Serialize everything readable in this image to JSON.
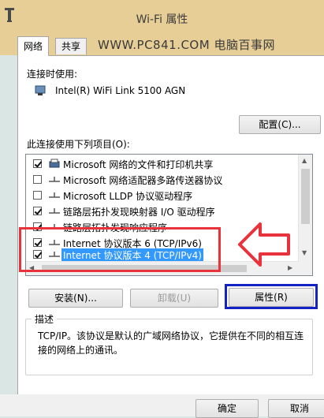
{
  "window": {
    "title": "Wi-Fi 属性"
  },
  "watermark": "WWW.PC841.COM 电脑百事网",
  "tabs": [
    {
      "label": "网络",
      "active": true
    },
    {
      "label": "共享",
      "active": false
    }
  ],
  "connect_using": {
    "label": "连接时使用:",
    "adapter": "Intel(R) WiFi Link 5100 AGN",
    "configure_button": "配置(C)..."
  },
  "items_label": "此连接使用下列项目(O):",
  "items": [
    {
      "label": "Microsoft 网络的文件和打印机共享",
      "checked": true,
      "icon": "printer-share-icon",
      "selected": false
    },
    {
      "label": "Microsoft 网络适配器多路传送器协议",
      "checked": false,
      "icon": "protocol-icon",
      "selected": false
    },
    {
      "label": "Microsoft LLDP 协议驱动程序",
      "checked": false,
      "icon": "protocol-icon",
      "selected": false
    },
    {
      "label": "链路层拓扑发现映射器 I/O 驱动程序",
      "checked": true,
      "icon": "protocol-icon",
      "selected": false
    },
    {
      "label": "链路层拓扑发现响应程序",
      "checked": true,
      "icon": "protocol-icon",
      "selected": false
    },
    {
      "label": "Internet 协议版本 6 (TCP/IPv6)",
      "checked": true,
      "icon": "protocol-icon",
      "selected": false
    },
    {
      "label": "Internet 协议版本 4 (TCP/IPv4)",
      "checked": true,
      "icon": "protocol-icon",
      "selected": true
    }
  ],
  "buttons": {
    "install": "安装(N)...",
    "uninstall": "卸载(U)",
    "properties": "属性(R)",
    "ok": "确定",
    "cancel": "取消"
  },
  "description": {
    "title": "描述",
    "text": "TCP/IP。该协议是默认的广域网络协议，它提供在不同的相互连接的网络上的通讯。"
  },
  "colors": {
    "title_bar": "#e6ce96",
    "selection": "#3399ff",
    "annotation_red": "#e8323c",
    "annotation_blue": "#1421c4"
  }
}
